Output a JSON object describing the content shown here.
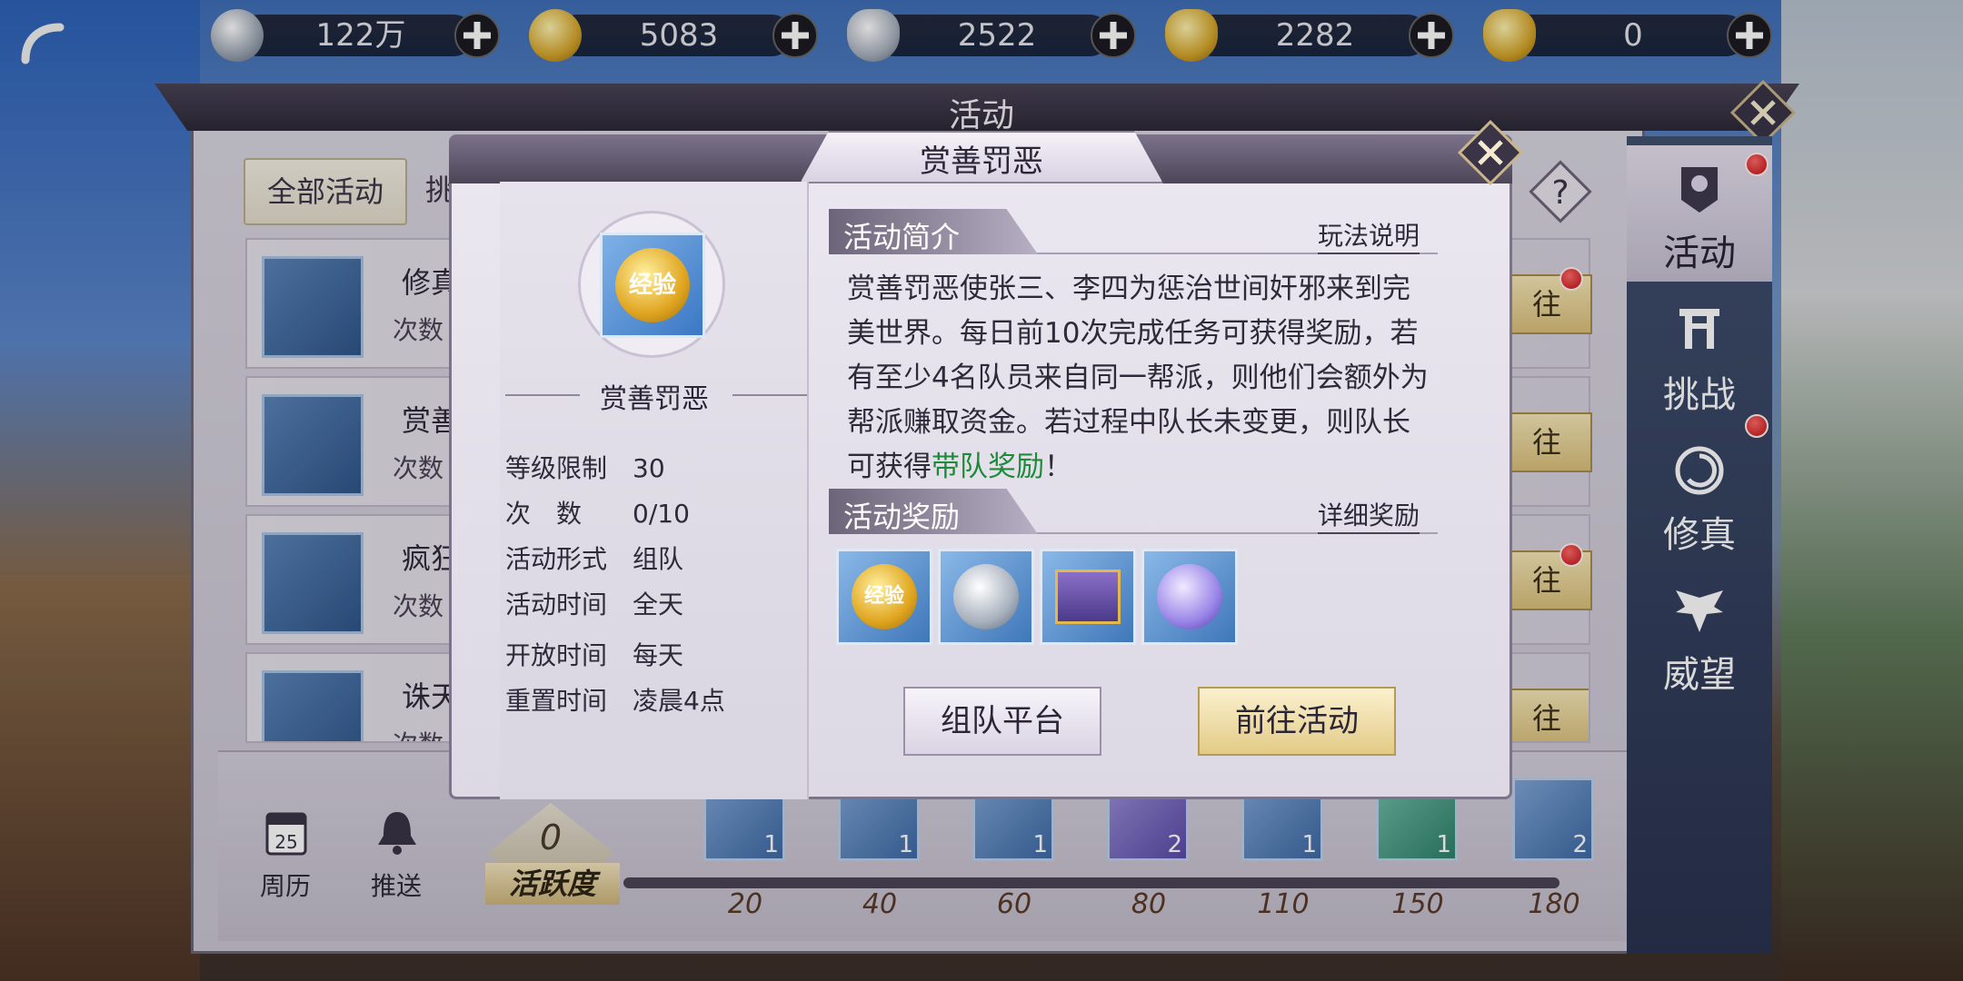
{
  "resources": [
    {
      "icon": "silver-coin-icon",
      "value": "122万"
    },
    {
      "icon": "gold-coin-icon",
      "value": "5083"
    },
    {
      "icon": "silver-ingot-icon",
      "value": "2522"
    },
    {
      "icon": "locked-gold-ingot-icon",
      "value": "2282"
    },
    {
      "icon": "gold-ingot-icon",
      "value": "0"
    }
  ],
  "panel": {
    "title": "活动"
  },
  "tabs": [
    {
      "label": "全部活动"
    },
    {
      "label": "挑"
    }
  ],
  "activity_list": [
    {
      "name": "修真",
      "count": "次数"
    },
    {
      "name": "赏善",
      "count": "次数"
    },
    {
      "name": "疯狂",
      "count": "次数"
    },
    {
      "name": "诛天",
      "count": "次数"
    }
  ],
  "go_label": "往",
  "help_icon": "?",
  "side_nav": [
    {
      "label": "活动",
      "active": true
    },
    {
      "label": "挑战",
      "active": false
    },
    {
      "label": "修真",
      "active": false
    },
    {
      "label": "威望",
      "active": false
    }
  ],
  "bottom": {
    "calendar_label": "周历",
    "calendar_day": "25",
    "push_label": "推送",
    "activity_value": "0",
    "activity_label": "活跃度",
    "milestones": [
      {
        "label": "20",
        "count": "1"
      },
      {
        "label": "40",
        "count": "1"
      },
      {
        "label": "60",
        "count": "1"
      },
      {
        "label": "80",
        "count": "2"
      },
      {
        "label": "110",
        "count": "1"
      },
      {
        "label": "150",
        "count": "1"
      },
      {
        "label": "180",
        "count": "2"
      }
    ]
  },
  "dialog": {
    "title": "赏善罚恶",
    "icon_text": "经验",
    "name": "赏善罚恶",
    "info": [
      {
        "k": "等级限制",
        "v": "30"
      },
      {
        "k": "次　数",
        "v": "0/10"
      },
      {
        "k": "活动形式",
        "v": "组队"
      },
      {
        "k": "活动时间",
        "v": "全天"
      },
      {
        "k": "开放时间",
        "v": "每天"
      },
      {
        "k": "重置时间",
        "v": "凌晨4点"
      }
    ],
    "intro_title": "活动简介",
    "intro_link": "玩法说明",
    "description": "赏善罚恶使张三、李四为惩治世间奸邪来到完美世界。每日前10次完成任务可获得奖励，若有至少4名队员来自同一帮派，则他们会额外为帮派赚取资金。若过程中队长未变更，则队长可获得",
    "description_highlight": "带队奖励",
    "description_end": "！",
    "reward_title": "活动奖励",
    "reward_link": "详细奖励",
    "rewards": [
      "exp-icon",
      "silver-coin-icon",
      "treasure-chest-icon",
      "spirit-orb-icon"
    ],
    "reward_exp_text": "经验",
    "team_button": "组队平台",
    "go_button": "前往活动"
  }
}
